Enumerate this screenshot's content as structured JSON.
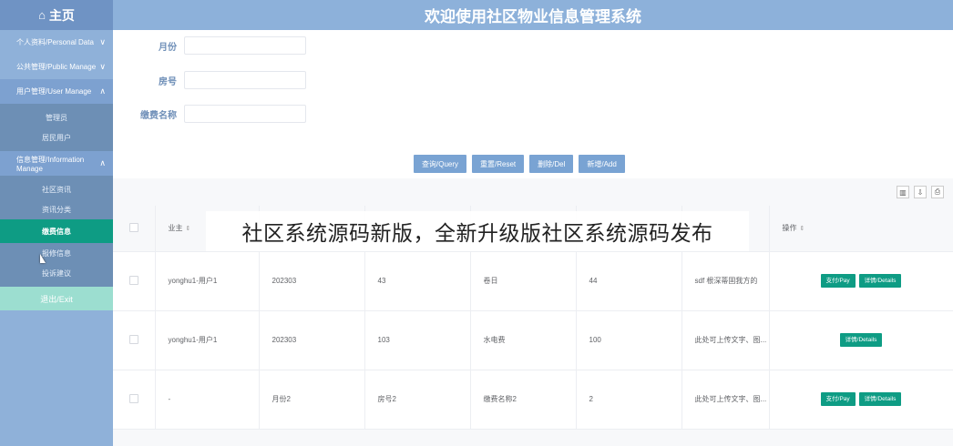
{
  "sidebar": {
    "home_label": "主页",
    "groups": [
      {
        "label": "个人资料/Personal Data"
      },
      {
        "label": "公共管理/Public Manage"
      },
      {
        "label": "用户管理/User Manage"
      },
      {
        "label": "信息管理/Information Manage"
      }
    ],
    "user_items": [
      {
        "label": "管理员"
      },
      {
        "label": "居民用户"
      }
    ],
    "info_items": [
      {
        "label": "社区资讯"
      },
      {
        "label": "资讯分类"
      },
      {
        "label": "缴费信息"
      },
      {
        "label": "报修信息"
      },
      {
        "label": "投诉建议"
      }
    ],
    "exit_label": "退出/Exit"
  },
  "header": {
    "title": "欢迎使用社区物业信息管理系统"
  },
  "search": {
    "month_label": "月份",
    "room_label": "房号",
    "fee_label": "缴费名称"
  },
  "actions": {
    "query": "查询/Query",
    "reset": "重置/Reset",
    "delete": "删除/Del",
    "add": "新增/Add"
  },
  "table": {
    "headers": {
      "owner": "业主",
      "ops": "操作"
    },
    "rows": [
      {
        "owner": "yonghu1-用户1",
        "month": "202303",
        "room": "43",
        "fee_name": "卷日",
        "amount": "44",
        "remark": "sdf 根深蒂固我方的",
        "pay": "支付/Pay",
        "details": "详情/Details"
      },
      {
        "owner": "yonghu1-用户1",
        "month": "202303",
        "room": "103",
        "fee_name": "水电费",
        "amount": "100",
        "remark": "此处可上传文字、图...",
        "pay": "",
        "details": "详情/Details"
      },
      {
        "owner": "-",
        "month": "月份2",
        "room": "房号2",
        "fee_name": "缴费名称2",
        "amount": "2",
        "remark": "此处可上传文字、图...",
        "pay": "支付/Pay",
        "details": "详情/Details"
      }
    ]
  },
  "banner": {
    "text": "社区系统源码新版，全新升级版社区系统源码发布"
  },
  "colors": {
    "sidebar": "#8fb1d9",
    "active": "#0e9c84",
    "header": "#8db1da",
    "button": "#79a3d3"
  }
}
